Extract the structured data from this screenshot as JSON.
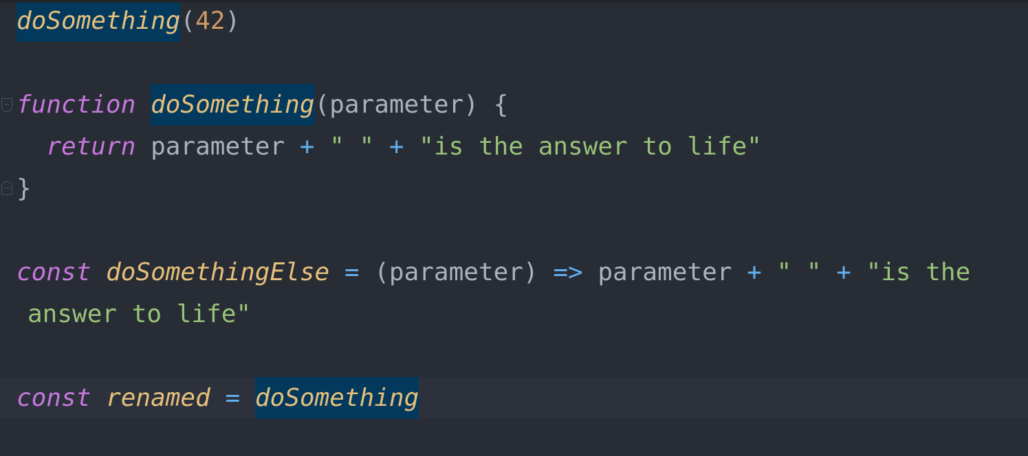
{
  "editor": {
    "lines": [
      {
        "tokens": [
          "doSomething",
          "(",
          "42",
          ")"
        ]
      },
      {
        "tokens": []
      },
      {
        "tokens": [
          "function",
          " ",
          "doSomething",
          "(parameter) {"
        ]
      },
      {
        "tokens": [
          "  ",
          "return",
          " parameter ",
          "+",
          " ",
          "\" \"",
          " ",
          "+",
          " ",
          "\"is the answer to life\""
        ]
      },
      {
        "tokens": [
          "}"
        ]
      },
      {
        "tokens": []
      },
      {
        "tokens": [
          "const",
          " ",
          "doSomethingElse",
          " ",
          "=",
          " (parameter) ",
          "=>",
          " parameter ",
          "+",
          " ",
          "\" \"",
          " ",
          "+",
          " ",
          "\"is the"
        ]
      },
      {
        "tokens": [
          "answer to life\""
        ]
      },
      {
        "tokens": []
      },
      {
        "tokens": [
          "const",
          " ",
          "renamed",
          " ",
          "=",
          " ",
          "doSomething"
        ]
      }
    ]
  },
  "colors": {
    "background": "#282c34",
    "current_line": "#2c313c",
    "keyword": "#c678dd",
    "function": "#e5c07b",
    "number": "#d19a66",
    "operator": "#61afef",
    "string": "#98c379",
    "text": "#abb2bf",
    "occurrence_highlight": "#04395e"
  },
  "icons": [
    "fold-open-icon",
    "fold-close-icon"
  ]
}
